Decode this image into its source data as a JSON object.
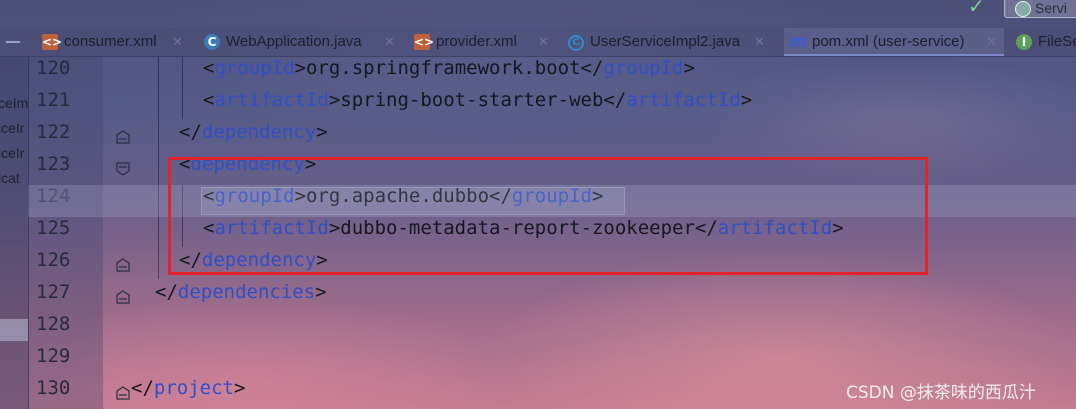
{
  "tabs": [
    {
      "label": "consumer.xml",
      "icon": "xml-file-icon",
      "active": false
    },
    {
      "label": "WebApplication.java",
      "icon": "spring-class-icon",
      "active": false
    },
    {
      "label": "provider.xml",
      "icon": "xml-file-icon",
      "active": false
    },
    {
      "label": "UserServiceImpl2.java",
      "icon": "class-icon",
      "active": false
    },
    {
      "label": "pom.xml (user-service)",
      "icon": "maven-icon",
      "active": true
    },
    {
      "label": "FileSe",
      "icon": "interface-icon",
      "active": false
    }
  ],
  "top_right": {
    "button_label": "Servi"
  },
  "project_panel": {
    "items": [
      "ceIm",
      "iceIr",
      "iceIr",
      "icat"
    ]
  },
  "editor": {
    "current_line": "124",
    "lines": [
      {
        "num": "120",
        "open": "groupId",
        "text": "org.springframework.boot",
        "close": "groupId"
      },
      {
        "num": "121",
        "open": "artifactId",
        "text": "spring-boot-starter-web",
        "close": "artifactId"
      },
      {
        "num": "122",
        "close_only": "dependency"
      },
      {
        "num": "123",
        "open_only": "dependency"
      },
      {
        "num": "124",
        "open": "groupId",
        "text": "org.apache.dubbo",
        "close": "groupId"
      },
      {
        "num": "125",
        "open": "artifactId",
        "text": "dubbo-metadata-report-zookeeper",
        "close": "artifactId"
      },
      {
        "num": "126",
        "close_only": "dependency"
      },
      {
        "num": "127",
        "close_only": "dependencies"
      },
      {
        "num": "128"
      },
      {
        "num": "129"
      },
      {
        "num": "130",
        "close_only": "project"
      }
    ]
  },
  "watermark": "CSDN @抹茶味的西瓜汁",
  "colors": {
    "tag": "#2e4fc9",
    "highlight_box": "#e2232b",
    "background_top": "#4c4f7b",
    "background_bottom": "#c47c91"
  }
}
